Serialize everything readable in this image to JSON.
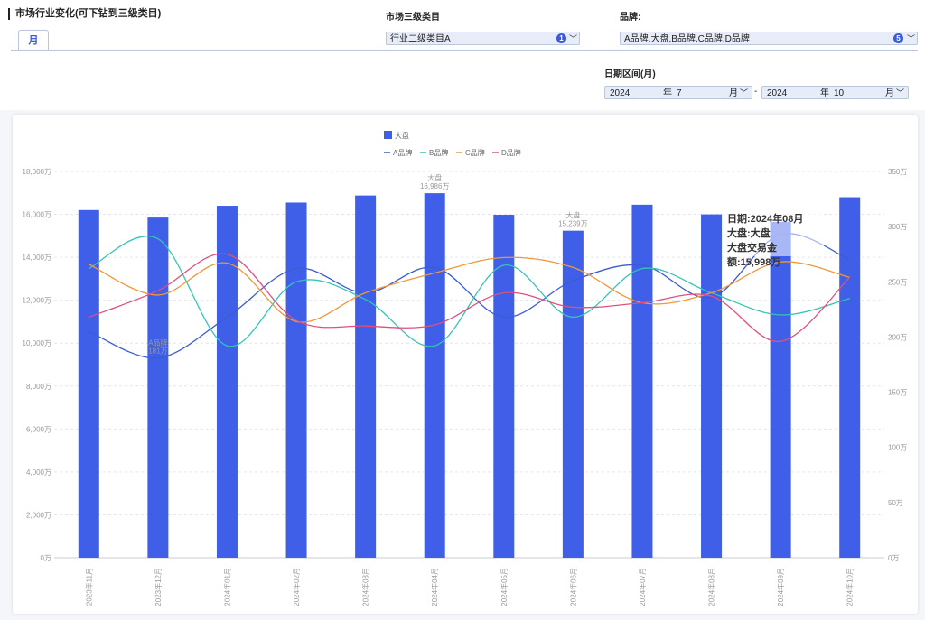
{
  "header": {
    "section_title": "市场行业变化(可下钻到三级类目)",
    "tab_month": "月"
  },
  "filters": {
    "category_label": "市场三级类目",
    "category_value": "行业二级类目A",
    "category_count": "1",
    "brand_label": "品牌:",
    "brand_value": "A品牌,大盘,B品牌,C品牌,D品牌",
    "brand_count": "5",
    "date_label": "日期区间(月)",
    "date_from": {
      "year": "2024",
      "year_unit": "年",
      "month": "7",
      "month_unit": "月"
    },
    "date_to": {
      "year": "2024",
      "year_unit": "年",
      "month": "10",
      "month_unit": "月"
    },
    "date_separator": "-"
  },
  "chart_data": {
    "type": "bar",
    "legend": {
      "bar": "大盘",
      "lines": [
        "A品牌",
        "B品牌",
        "C品牌",
        "D品牌"
      ]
    },
    "categories": [
      "2023年11月",
      "2023年12月",
      "2024年01月",
      "2024年02月",
      "2024年03月",
      "2024年04月",
      "2024年05月",
      "2024年06月",
      "2024年07月",
      "2024年08月",
      "2024年09月",
      "2024年10月"
    ],
    "left_axis": {
      "ticks": [
        "0万",
        "2,000万",
        "4,000万",
        "6,000万",
        "8,000万",
        "10,000万",
        "12,000万",
        "14,000万",
        "16,000万",
        "18,000万"
      ],
      "max": 18000
    },
    "right_axis": {
      "ticks": [
        "0万",
        "50万",
        "100万",
        "150万",
        "200万",
        "250万",
        "300万",
        "350万"
      ],
      "max": 350
    },
    "bar_series": {
      "name": "大盘",
      "values": [
        16200,
        15850,
        16400,
        16550,
        16880,
        16986,
        15980,
        15239,
        16450,
        15998,
        15650,
        16800
      ],
      "color": "#3f5fe8"
    },
    "line_series": [
      {
        "name": "A品牌",
        "color": "#3b5bd6",
        "values": [
          205,
          181,
          218,
          262,
          240,
          263,
          218,
          251,
          265,
          236,
          293,
          270
        ]
      },
      {
        "name": "B品牌",
        "color": "#35c4b4",
        "values": [
          262,
          289,
          192,
          250,
          234,
          192,
          265,
          218,
          262,
          240,
          220,
          235
        ]
      },
      {
        "name": "C品牌",
        "color": "#f0973c",
        "values": [
          266,
          238,
          267,
          214,
          240,
          258,
          272,
          263,
          231,
          240,
          268,
          254
        ]
      },
      {
        "name": "D品牌",
        "color": "#e0507e",
        "values": [
          218,
          242,
          275,
          215,
          210,
          211,
          240,
          227,
          231,
          237,
          196,
          254
        ]
      }
    ],
    "annotations": [
      {
        "index": 5,
        "series": "大盘",
        "label": "大盘",
        "value_text": "16,986万"
      },
      {
        "index": 7,
        "series": "大盘",
        "label": "大盘",
        "value_text": "15,239万"
      },
      {
        "index": 1,
        "series": "A品牌",
        "label": "A品牌",
        "value_text": "181万"
      }
    ],
    "tooltip": {
      "line1": "日期:2024年08月",
      "line2": "大盘:大盘",
      "line3": "大盘交易金额:15,998万"
    }
  }
}
